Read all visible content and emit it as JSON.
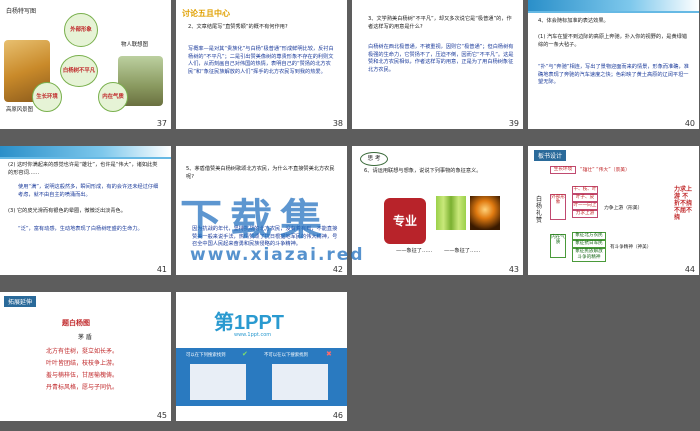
{
  "slides": [
    {
      "num": "37",
      "title": "白杨特写图",
      "labels": [
        "外部形象",
        "白杨树不平凡",
        "生长环境",
        "内在气质",
        "高原风景图",
        "物人联想图"
      ]
    },
    {
      "num": "38",
      "title": "讨论五且中心",
      "q": "2、文章结尾写“直赞秀颖”的概不有何作用?",
      "body": "写概率—是对其“贵族化”与白杨“极普通”形成鲜明比较，反衬白杨树的“不平凡”；二是引出赞美像树的尊贵形象不存在的利则文人们，从而刻画自己对伟国的热情，表明自己的“赞扬的北方农民”和“象征民族解放的人们”挥手的北方农民写到我的热爱。"
    },
    {
      "num": "39",
      "q": "3、文学熟美白杨树“不平凡”，却又多次说它是“极普通”的，作者这样写的用意是什么?",
      "body": "白杨树在西北极普通，不被重视，因则它“极普通”；但白杨树有极强的生命力，它赞扬不了，压迫不倒，因而它“不平凡”。这是赞和北方农民相似，作者这样写的用意，正是为了用白杨树象征北方农民。"
    },
    {
      "num": "40",
      "q": "4、体会随标加准的表达效果。",
      "items": [
        "(1)   汽车在望不到边际的高原上奔驰，扑入你的视野的，是黄绿错综的一条大毡子。",
        "“扑”与“奔驰”相连，写出了景物迎面而来的情景，形象而准确，准确地表现了奔驰的汽车速度之快；色彩映了黄土高原的辽阔平坦一望无际。"
      ]
    },
    {
      "num": "41",
      "items": [
        "(2) 这时你满起来的感觉也许是“雄壮”，也许是“伟大”，诸如此类的形容词……",
        "使用“满”，说明这般然多，瞬间形成，有的会许还未经过仔细考虑，就不由自主的喷涌而出。",
        "(3) 它的皮光滑而有银色的晕圈，微微泛出淡青色。",
        "“泛”，富有动感，生动地表现了白杨树旺盛的生命力。"
      ]
    },
    {
      "num": "42",
      "q": "5、茅盾借赞美白杨树歌颂北方农民，为什么不直接赞美北方农民呢?",
      "body": "因为抗战的年代，坚持抗战的北方农民，没有着有到，不能直接赞美一般来说手法，热情赞颂了抗日根据地军民的伟大精神，号召全中国人民起来奋勇和民族侵略的斗争精神。"
    },
    {
      "num": "43",
      "think": "思  考",
      "q": "6、请运用联想与想象，说说下列事物的象征意义。",
      "label1": "专业",
      "label2": "——象征了……",
      "label3": "——象征了……"
    },
    {
      "num": "44",
      "title": "板书设计",
      "vertical": "白杨礼赞",
      "top": [
        "生长环境",
        "“雄壮”",
        "“伟大”（景美）"
      ],
      "midlabel": "外部形象",
      "boxes": [
        "干、枝、叶",
        "叶子、皮",
        "叶一一向上",
        "力求上游"
      ],
      "right": [
        "力争上游（形美）"
      ],
      "inner": "内在气质",
      "innerbox": [
        "象征北方农民",
        "象征抗日军民",
        "象征民族解放斗争的精神"
      ],
      "right2": "有斗争精神（神美）",
      "side": "力求上游 不折不挠 不屈不挠"
    },
    {
      "num": "45",
      "title": "拓展延伸",
      "poem_title": "题白杨图",
      "author": "茅  盾",
      "lines": [
        "北方有佳树，挺立如长矛。",
        "叶叶皆团结，枝枝争上游。",
        "羞与楠梓伍，甘居榆槐俦。",
        "丹青标风格，愿与子同仇。"
      ]
    },
    {
      "num": "46",
      "logo": "第1PPT",
      "url": "www.1ppt.com",
      "note1": "可以在下列搜索找到",
      "note2": "不可以在以下搜索找到"
    }
  ],
  "watermark": {
    "text": "下载集",
    "url": "www.xiazai.red"
  }
}
